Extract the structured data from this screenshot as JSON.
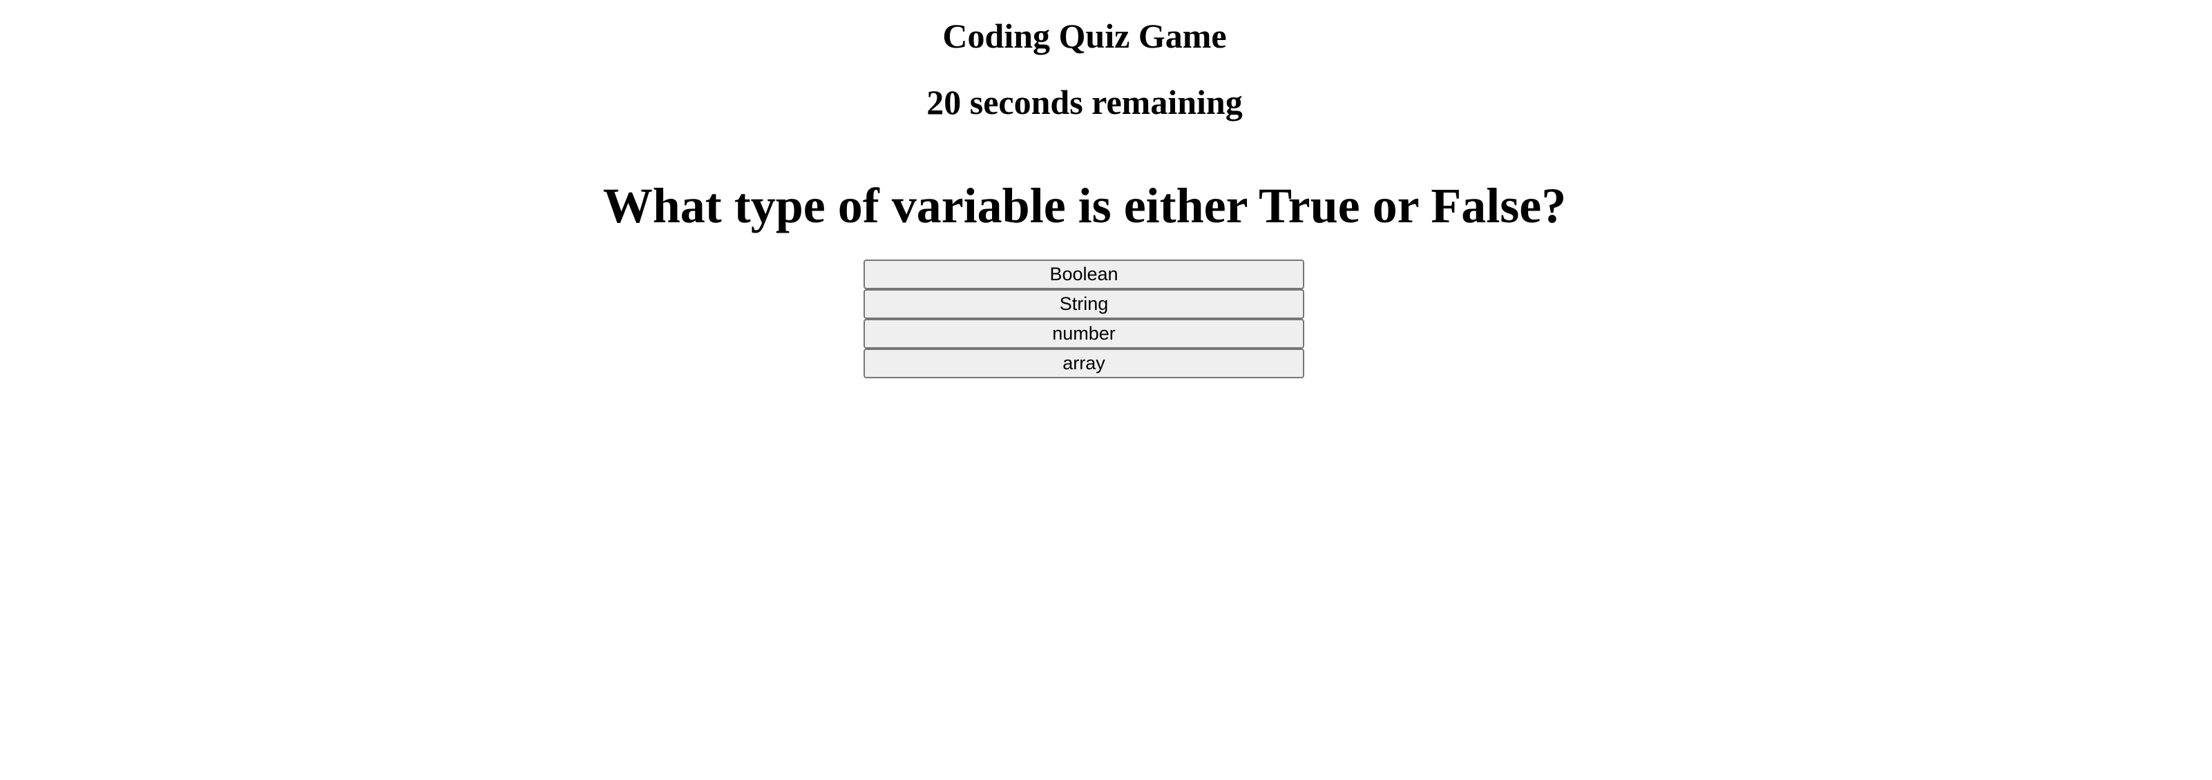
{
  "header": {
    "title": "Coding Quiz Game",
    "timer_text": "20 seconds remaining"
  },
  "quiz": {
    "question": "What type of variable is either True or False?",
    "answers": [
      {
        "label": "Boolean"
      },
      {
        "label": "String"
      },
      {
        "label": "number"
      },
      {
        "label": "array"
      }
    ]
  }
}
